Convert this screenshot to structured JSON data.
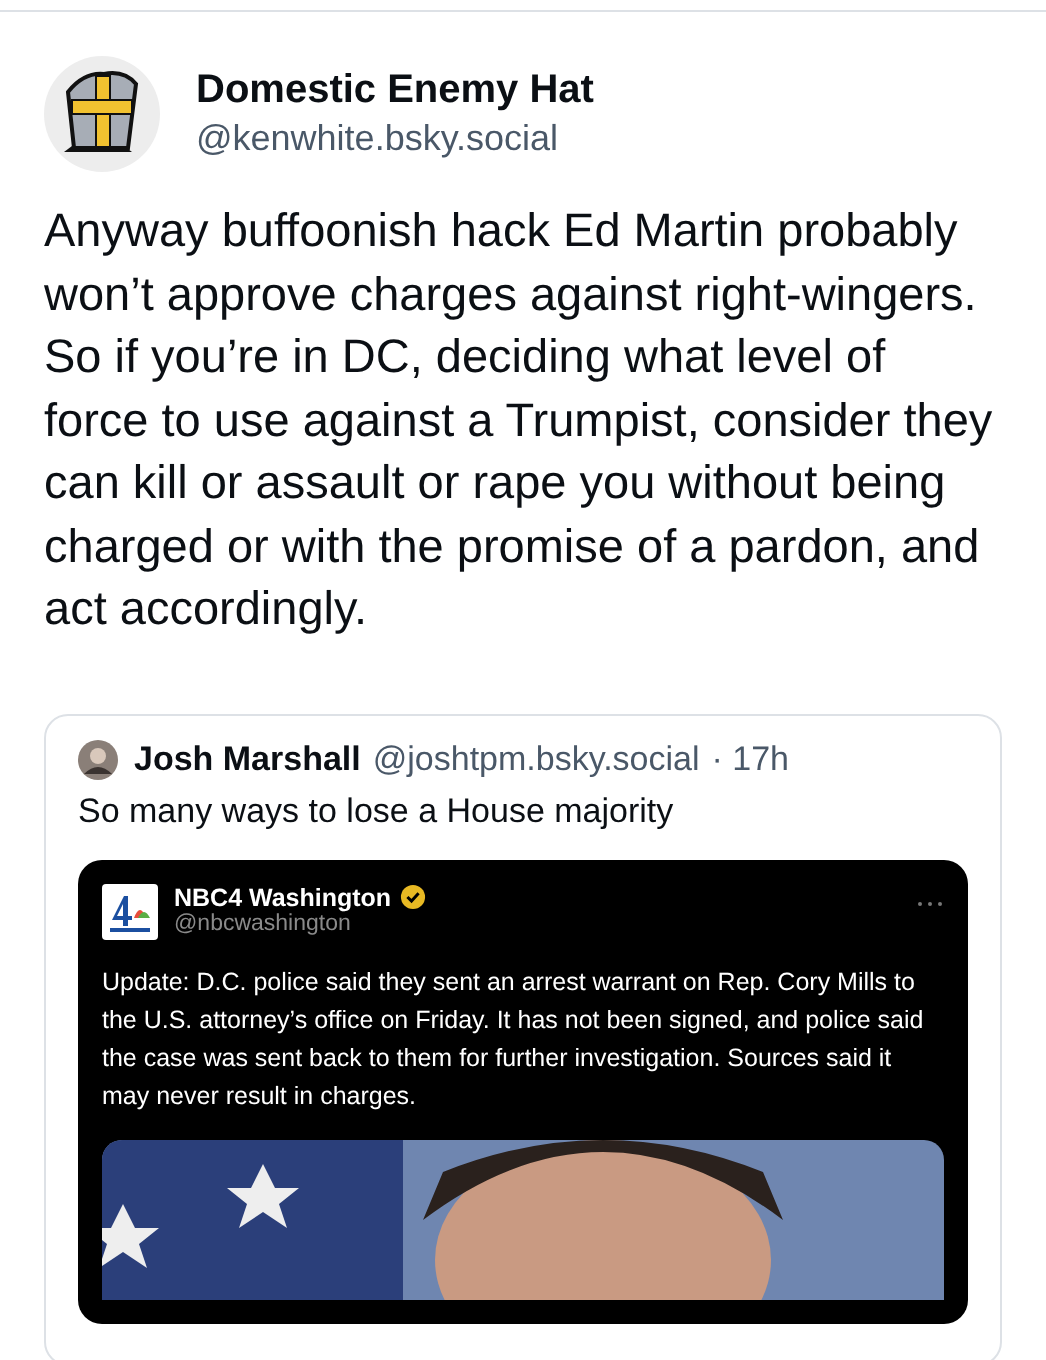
{
  "post": {
    "author": "Domestic Enemy Hat",
    "handle": "@kenwhite.bsky.social",
    "text": "Anyway buffoonish hack Ed Martin probably won’t approve charges against right-wingers. So if you’re in DC, deciding what level of force to use against a Trumpist, consider they can kill or assault or rape you without being charged or with the promise of a pardon, and act accordingly."
  },
  "quote": {
    "author": "Josh Marshall",
    "handle": "@joshtpm.bsky.social",
    "time": "· 17h",
    "text": "So many ways to lose a House majority",
    "embed": {
      "author": "NBC4 Washington",
      "verified": true,
      "handle": "@nbcwashington",
      "text": "Update: D.C. police said they sent an arrest warrant on Rep. Cory Mills to the U.S. attorney’s office on Friday. It has not been signed, and police said the case was sent back to them for further investigation. Sources said it may never result in charges."
    }
  }
}
